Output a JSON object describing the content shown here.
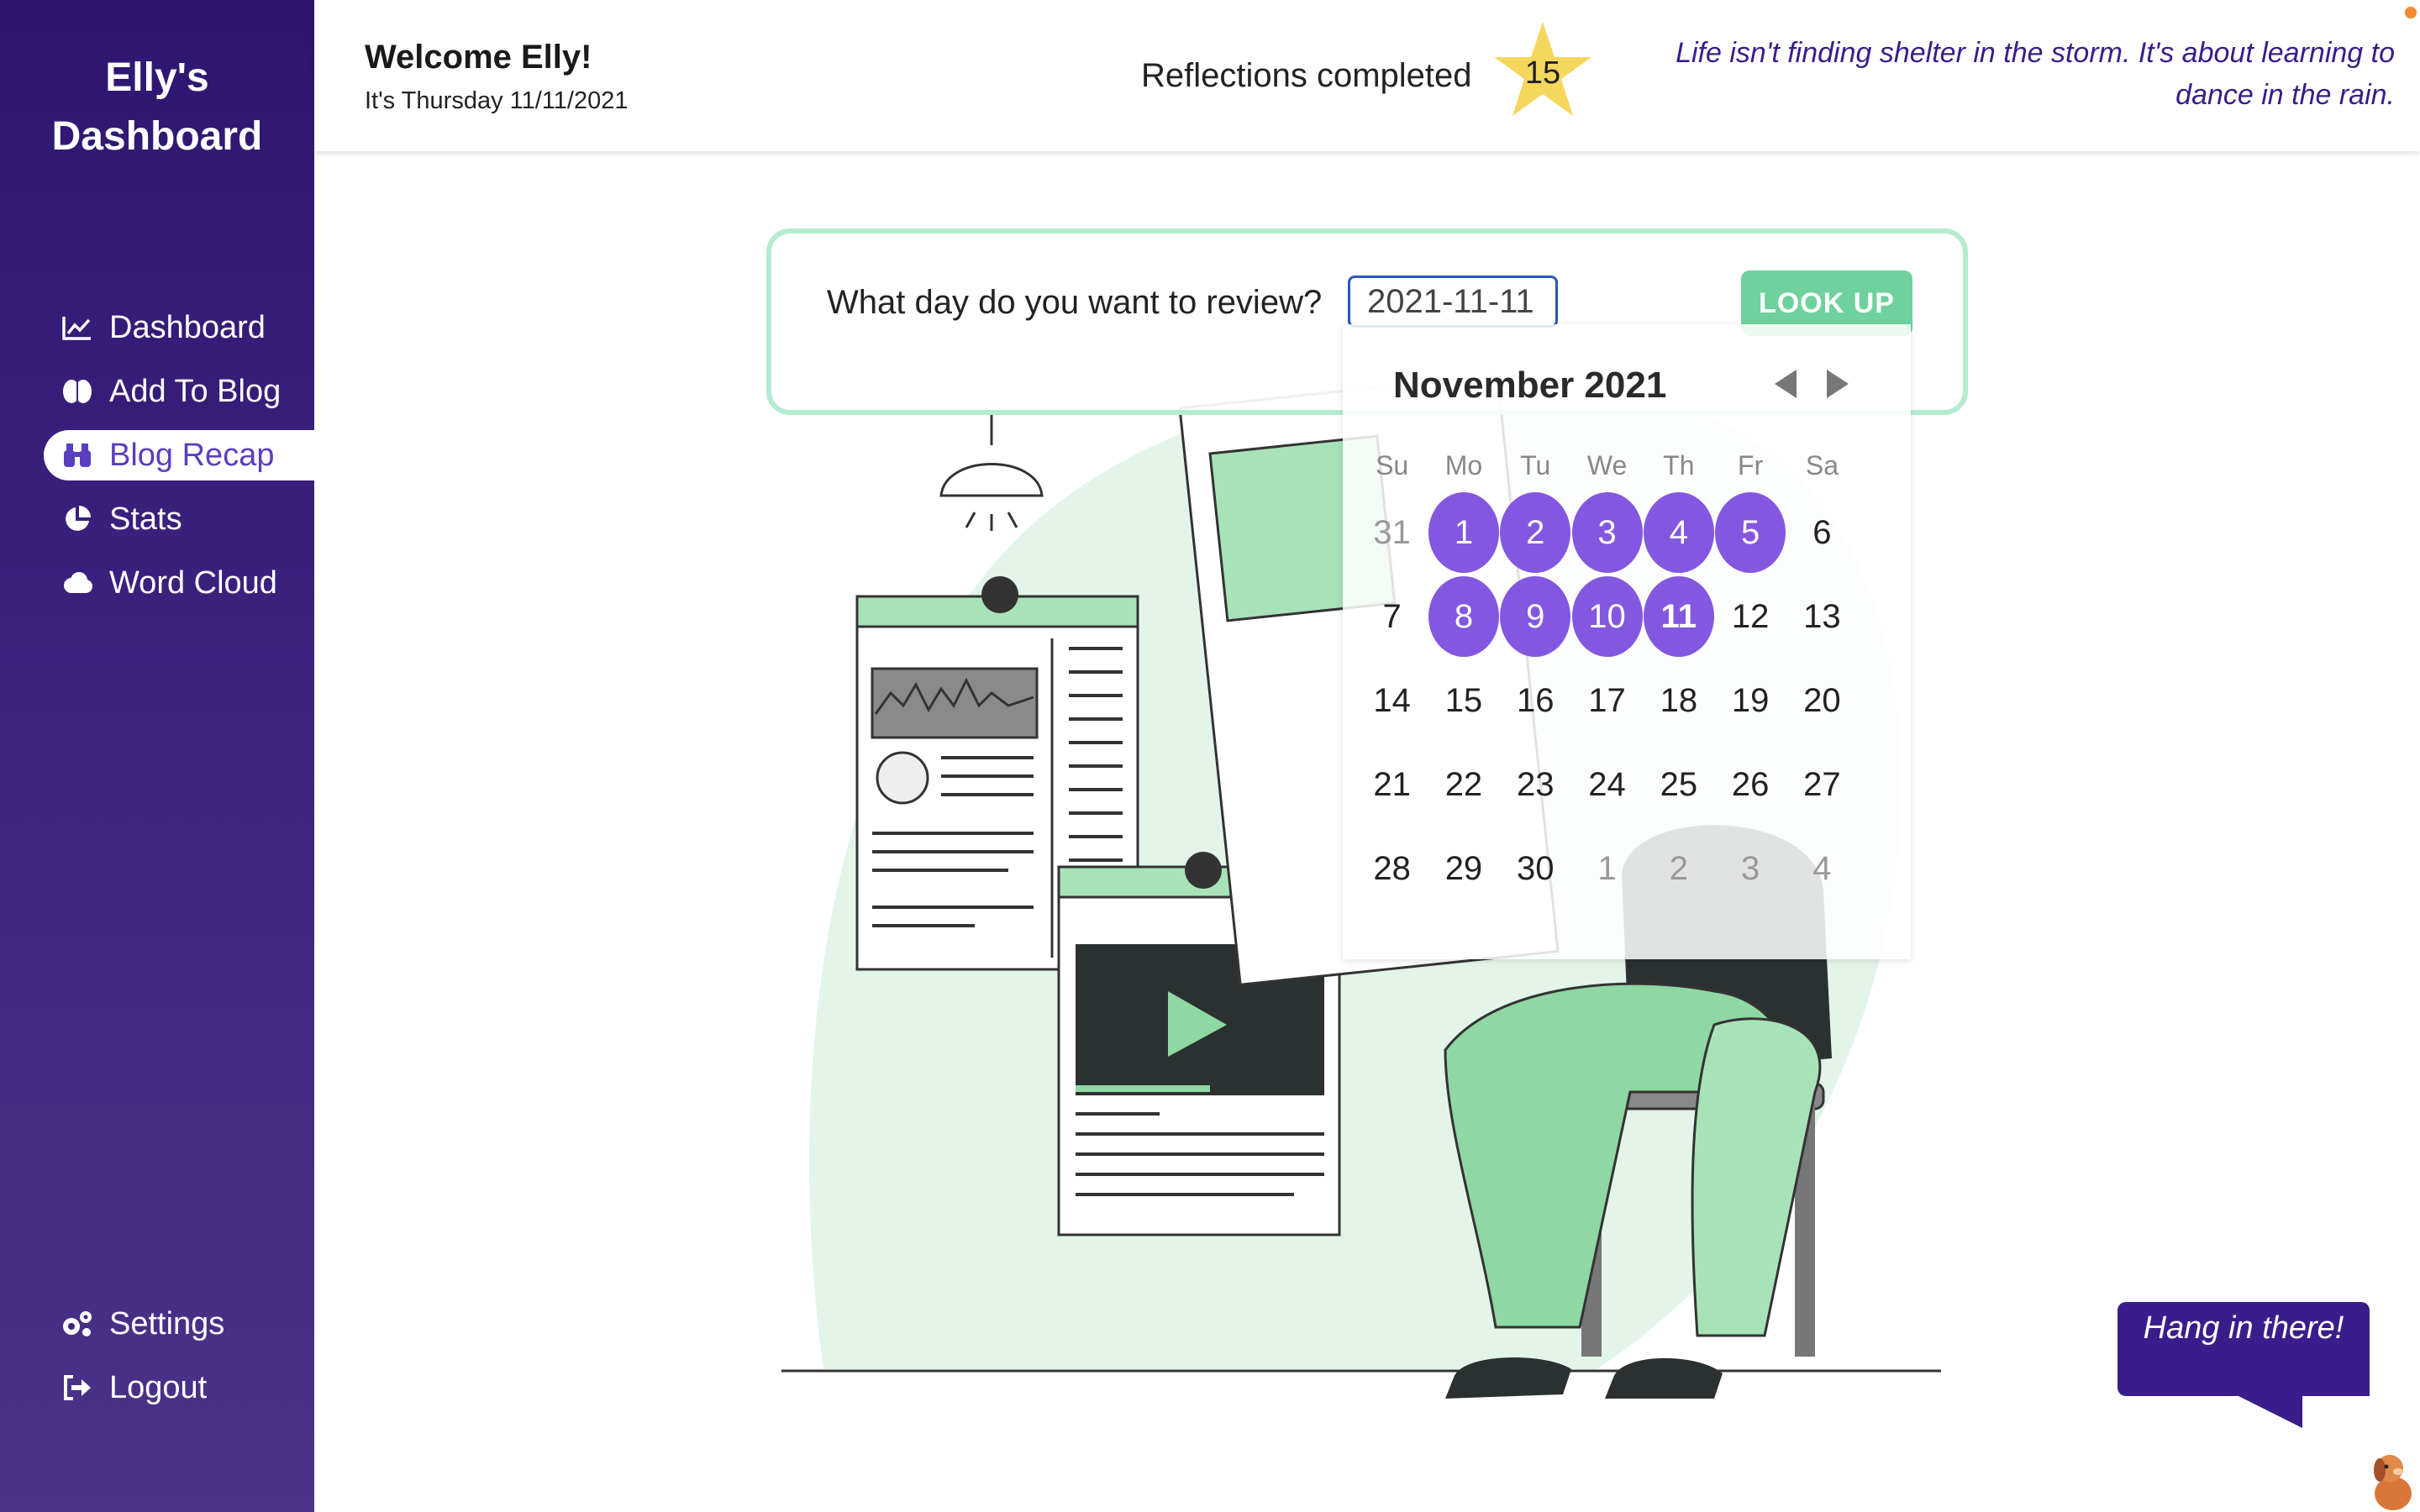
{
  "sidebar": {
    "brand_line1": "Elly's",
    "brand_line2": "Dashboard",
    "items": [
      {
        "label": "Dashboard",
        "icon": "chart-line-icon",
        "active": false
      },
      {
        "label": "Add To Blog",
        "icon": "brain-icon",
        "active": false
      },
      {
        "label": "Blog Recap",
        "icon": "binoculars-icon",
        "active": true
      },
      {
        "label": "Stats",
        "icon": "pie-chart-icon",
        "active": false
      },
      {
        "label": "Word Cloud",
        "icon": "cloud-icon",
        "active": false
      }
    ],
    "bottom_items": [
      {
        "label": "Settings",
        "icon": "gears-icon"
      },
      {
        "label": "Logout",
        "icon": "sign-out-icon"
      }
    ]
  },
  "header": {
    "welcome": "Welcome Elly!",
    "date": "It's Thursday 11/11/2021",
    "reflections_label": "Reflections completed",
    "reflections_count": "15",
    "quote": "Life isn't finding shelter in the storm. It's about learning to dance in the rain."
  },
  "review": {
    "question": "What day do you want to review?",
    "date_value": "2021-11-11",
    "lookup_label": "LOOK UP"
  },
  "calendar": {
    "title": "November 2021",
    "weekdays": [
      "Su",
      "Mo",
      "Tu",
      "We",
      "Th",
      "Fr",
      "Sa"
    ],
    "weeks": [
      [
        "31",
        "1",
        "2",
        "3",
        "4",
        "5",
        "6"
      ],
      [
        "7",
        "8",
        "9",
        "10",
        "11",
        "12",
        "13"
      ],
      [
        "14",
        "15",
        "16",
        "17",
        "18",
        "19",
        "20"
      ],
      [
        "21",
        "22",
        "23",
        "24",
        "25",
        "26",
        "27"
      ],
      [
        "28",
        "29",
        "30",
        "1",
        "2",
        "3",
        "4"
      ]
    ],
    "marked_days": [
      "1",
      "2",
      "3",
      "4",
      "5",
      "8",
      "9",
      "10",
      "11"
    ],
    "selected_day": "11"
  },
  "mascot": {
    "bubble_text": "Hang in there!"
  },
  "colors": {
    "sidebar": "#3d2280",
    "accent_purple": "#8457e0",
    "accent_green": "#6fd19e",
    "border_green": "#b4ecd0",
    "quote_text": "#3a1d8a"
  }
}
